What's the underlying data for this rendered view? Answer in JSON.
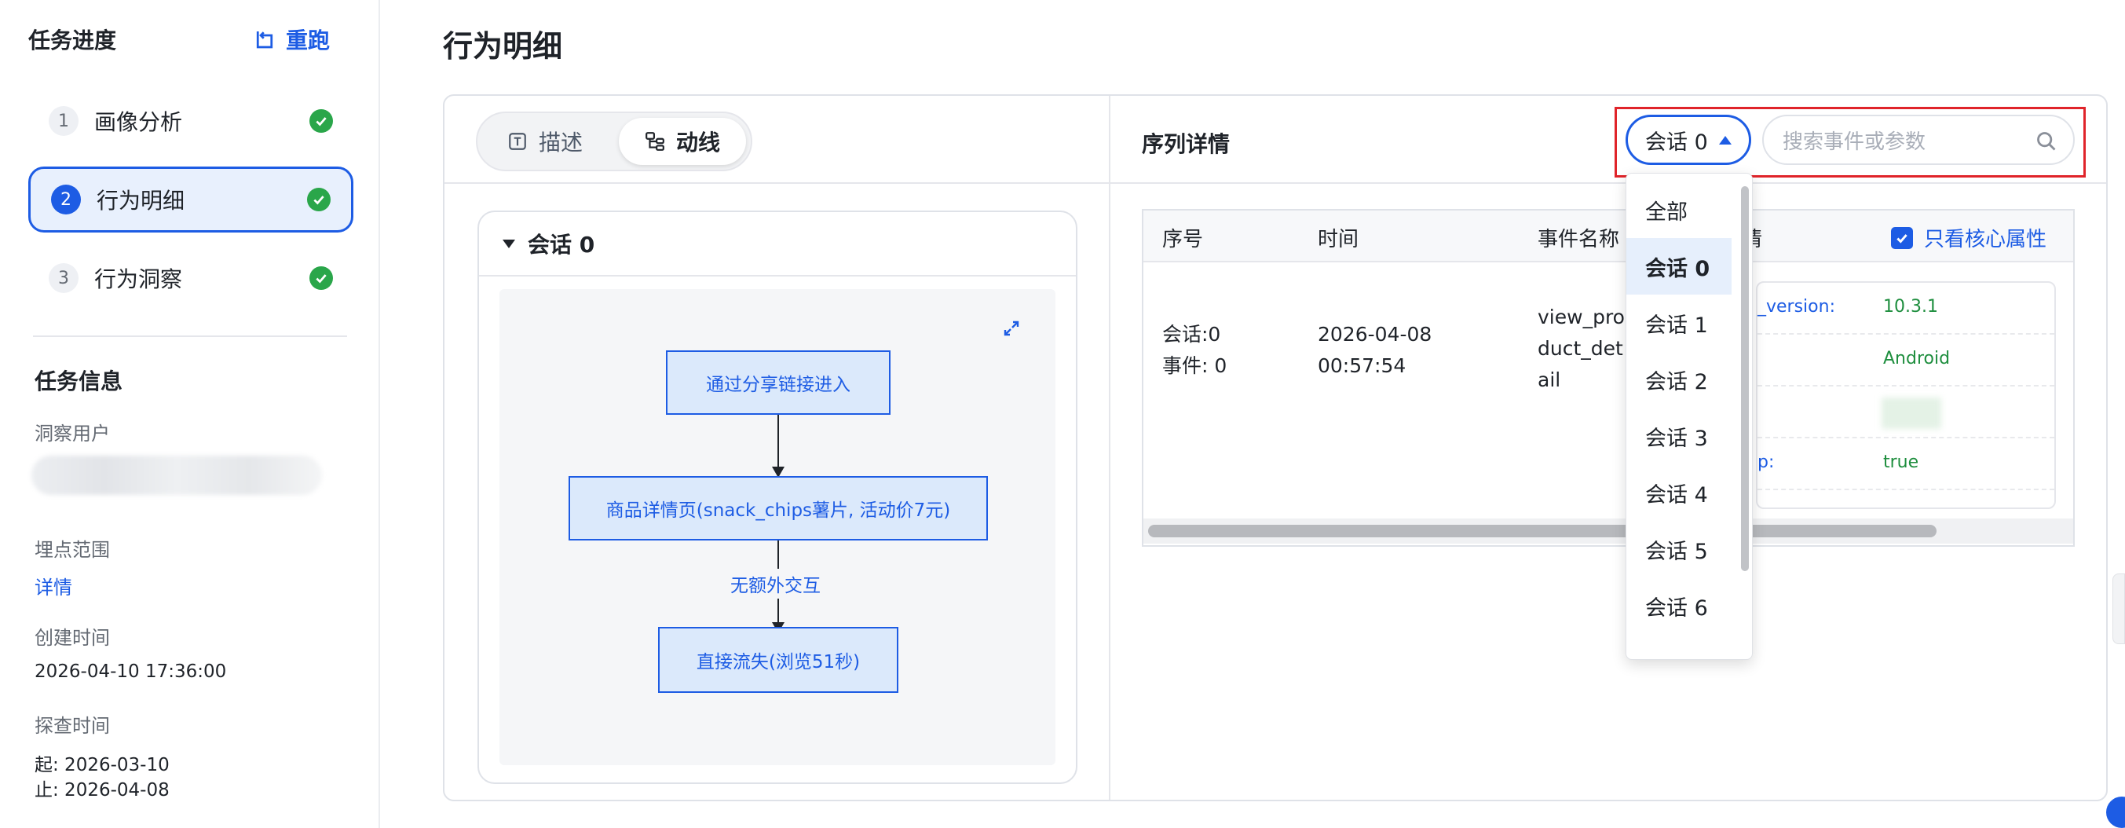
{
  "sidebar": {
    "title": "任务进度",
    "rerun_label": "重跑",
    "steps": [
      {
        "num": "1",
        "label": "画像分析"
      },
      {
        "num": "2",
        "label": "行为明细"
      },
      {
        "num": "3",
        "label": "行为洞察"
      }
    ],
    "active_step": "2",
    "info_title": "任务信息",
    "insight_user_label": "洞察用户",
    "tracking_scope_label": "埋点范围",
    "tracking_scope_link": "详情",
    "created_label": "创建时间",
    "created_value": "2026-04-10 17:36:00",
    "explore_label": "探查时间",
    "explore_start": "起: 2026-03-10",
    "explore_end": "止: 2026-04-08"
  },
  "main": {
    "page_title": "行为明细",
    "tabs": [
      {
        "label": "描述",
        "icon": "text-box-icon"
      },
      {
        "label": "动线",
        "icon": "flow-tree-icon"
      }
    ],
    "active_tab": "动线",
    "flow": {
      "session_title": "会话 0",
      "nodes": [
        "通过分享链接进入",
        "商品详情页(snack_chips薯片, 活动价7元)",
        "直接流失(浏览51秒)"
      ],
      "edge_label": "无额外交互"
    },
    "sequence": {
      "title": "序列详情",
      "session_select_value": "会话 0",
      "search_placeholder": "搜索事件或参数",
      "columns": [
        "序号",
        "时间",
        "事件名称",
        "详情"
      ],
      "visible_detail_header": "情",
      "core_only_label": "只看核心属性",
      "core_only_checked": true,
      "row": {
        "seq_line1": "会话:0",
        "seq_line2": "事件: 0",
        "time_line1": "2026-04-08",
        "time_line2": "00:57:54",
        "event_line1": "view_pro",
        "event_line2": "duct_det",
        "event_line3": "ail"
      },
      "props": [
        {
          "key": "_version:",
          "value": "10.3.1"
        },
        {
          "key": "",
          "value": "Android"
        },
        {
          "key": "",
          "value": ""
        },
        {
          "key": "p:",
          "value": "true"
        }
      ],
      "dropdown_options": [
        "全部",
        "会话 0",
        "会话 1",
        "会话 2",
        "会话 3",
        "会话 4",
        "会话 5",
        "会话 6"
      ],
      "dropdown_selected": "会话 0"
    }
  },
  "colors": {
    "accent": "#1d5ce4",
    "success": "#2aa64a",
    "highlight_border": "#e0242a",
    "node_fill": "#dbe9fb",
    "prop_value": "#1e8e3e"
  }
}
